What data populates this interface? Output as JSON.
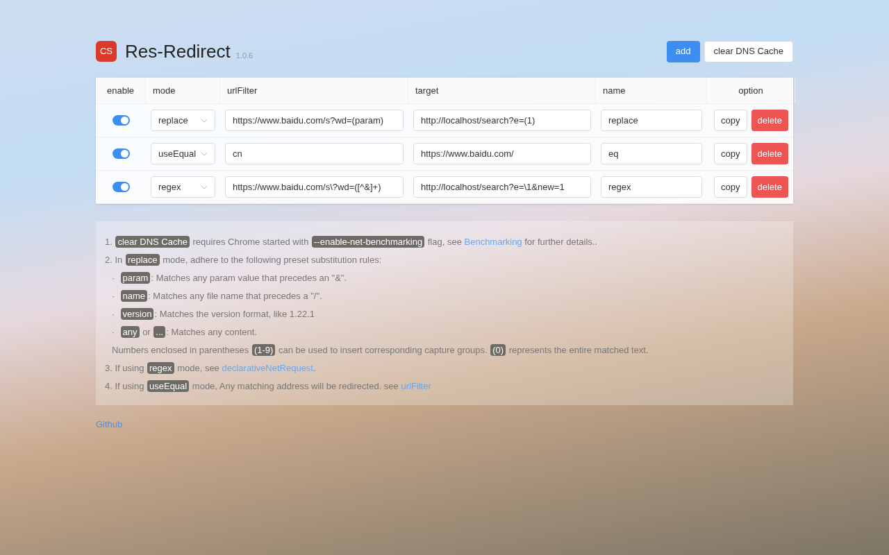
{
  "header": {
    "logo": "CS",
    "title": "Res-Redirect",
    "version": "1.0.6",
    "buttons": [
      {
        "label": "add",
        "kind": "primary"
      },
      {
        "label": "clear DNS Cache",
        "kind": "default"
      }
    ]
  },
  "table": {
    "columns": [
      "enable",
      "mode",
      "urlFilter",
      "target",
      "name",
      "option"
    ],
    "rows": [
      {
        "enabled": true,
        "mode": "replace",
        "urlFilter": "https://www.baidu.com/s?wd=(param)",
        "target": "http://localhost/search?e=(1)",
        "name": "replace",
        "actions": [
          "copy",
          "delete"
        ]
      },
      {
        "enabled": true,
        "mode": "useEqual",
        "urlFilter": "cn",
        "target": "https://www.baidu.com/",
        "name": "eq",
        "actions": [
          "copy",
          "delete"
        ]
      },
      {
        "enabled": true,
        "mode": "regex",
        "urlFilter": "https://www.baidu.com/s\\?wd=([^&]+)",
        "target": "http://localhost/search?e=\\1&new=1",
        "name": "regex",
        "actions": [
          "copy",
          "delete"
        ]
      }
    ]
  },
  "notes": [
    {
      "marker": "1.",
      "segments": [
        {
          "kind": "code",
          "text": "clear DNS Cache"
        },
        {
          "kind": "text",
          "text": " requires Chrome started with "
        },
        {
          "kind": "code",
          "text": "--enable-net-benchmarking"
        },
        {
          "kind": "text",
          "text": " flag, see "
        },
        {
          "kind": "link",
          "text": "Benchmarking"
        },
        {
          "kind": "text",
          "text": " for further details.."
        }
      ]
    },
    {
      "marker": "2.",
      "segments": [
        {
          "kind": "text",
          "text": "In "
        },
        {
          "kind": "code",
          "text": "replace"
        },
        {
          "kind": "text",
          "text": " mode, adhere to the following preset substitution rules:"
        }
      ],
      "children": [
        {
          "marker": "·",
          "segments": [
            {
              "kind": "code",
              "text": "param"
            },
            {
              "kind": "text",
              "text": ": Matches any param value that precedes an \"&\"."
            }
          ]
        },
        {
          "marker": "·",
          "segments": [
            {
              "kind": "code",
              "text": "name"
            },
            {
              "kind": "text",
              "text": ": Matches any file name that precedes a \"/\"."
            }
          ]
        },
        {
          "marker": "·",
          "segments": [
            {
              "kind": "code",
              "text": "version"
            },
            {
              "kind": "text",
              "text": ": Matches the version format, like 1.22.1"
            }
          ]
        },
        {
          "marker": "·",
          "segments": [
            {
              "kind": "code",
              "text": "any"
            },
            {
              "kind": "text",
              "text": " or "
            },
            {
              "kind": "code",
              "text": "..."
            },
            {
              "kind": "text",
              "text": ": Matches any content."
            }
          ]
        },
        {
          "segments": [
            {
              "kind": "text",
              "text": "Numbers enclosed in parentheses "
            },
            {
              "kind": "code",
              "text": "(1-9)"
            },
            {
              "kind": "text",
              "text": " can be used to insert corresponding capture groups. "
            },
            {
              "kind": "code",
              "text": "(0)"
            },
            {
              "kind": "text",
              "text": " represents the entire matched text."
            }
          ]
        }
      ]
    },
    {
      "marker": "3.",
      "segments": [
        {
          "kind": "text",
          "text": "If using "
        },
        {
          "kind": "code",
          "text": "regex"
        },
        {
          "kind": "text",
          "text": " mode, see "
        },
        {
          "kind": "link",
          "text": "declarativeNetRequest"
        },
        {
          "kind": "text",
          "text": "."
        }
      ]
    },
    {
      "marker": "4.",
      "segments": [
        {
          "kind": "text",
          "text": "If using "
        },
        {
          "kind": "code",
          "text": "useEqual"
        },
        {
          "kind": "text",
          "text": " mode, Any matching address will be redirected. see "
        },
        {
          "kind": "link",
          "text": "urlFilter"
        }
      ]
    }
  ],
  "footer_link": "Github"
}
